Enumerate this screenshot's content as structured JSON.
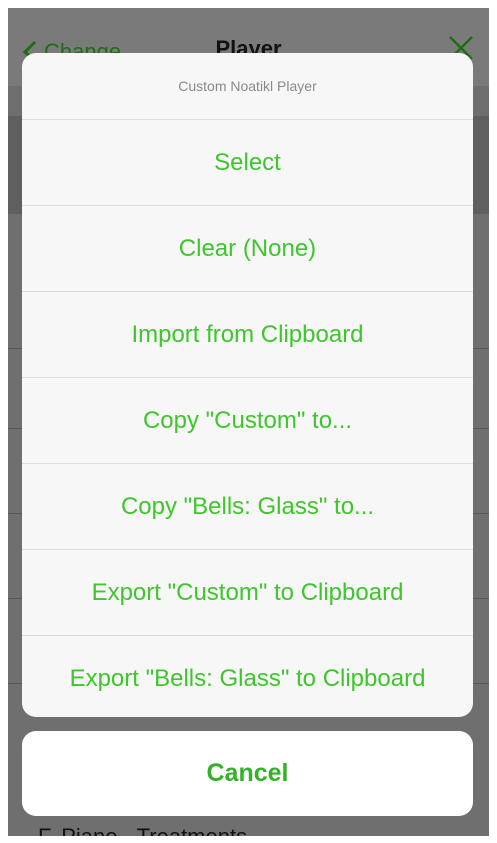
{
  "nav": {
    "back_label": "Change",
    "title": "Player"
  },
  "background": {
    "partial_row_label": "F. Piano - Treatments"
  },
  "action_sheet": {
    "title": "Custom Noatikl Player",
    "items": [
      "Select",
      "Clear (None)",
      "Import from Clipboard",
      "Copy \"Custom\" to...",
      "Copy \"Bells: Glass\" to...",
      "Export \"Custom\" to Clipboard",
      "Export \"Bells: Glass\" to Clipboard"
    ],
    "cancel_label": "Cancel"
  },
  "colors": {
    "accent": "#3ec62c",
    "cancel_text": "#34b225"
  },
  "icons": {
    "back": "chevron-left-icon",
    "close": "close-icon"
  }
}
